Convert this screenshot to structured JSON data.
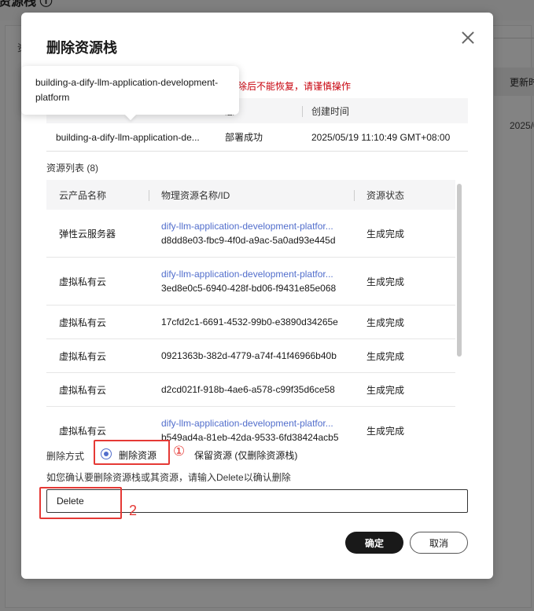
{
  "background": {
    "title": "资源栈 ⓘ",
    "left_text": "资",
    "col_header": "更新时",
    "col_cell": "2025/0"
  },
  "dialog": {
    "title": "删除资源栈",
    "warning": "除后不能恢复，请谨慎操作",
    "tooltip": "building-a-dify-llm-application-development-platform",
    "stack_table": {
      "headers": [
        "",
        "态",
        "创建时间"
      ],
      "row": [
        "building-a-dify-llm-application-de...",
        "部署成功",
        "2025/05/19 11:10:49 GMT+08:00"
      ]
    },
    "resource_label": "资源列表 (8)",
    "resource_table": {
      "headers": [
        "云产品名称",
        "物理资源名称/ID",
        "资源状态"
      ],
      "rows": [
        {
          "product": "弹性云服务器",
          "link": "dify-llm-application-development-platfor...",
          "id": "d8dd8e03-fbc9-4f0d-a9ac-5a0ad93e445d",
          "status": "生成完成"
        },
        {
          "product": "虚拟私有云",
          "link": "dify-llm-application-development-platfor...",
          "id": "3ed8e0c5-6940-428f-bd06-f9431e85e068",
          "status": "生成完成"
        },
        {
          "product": "虚拟私有云",
          "link": "",
          "id": "17cfd2c1-6691-4532-99b0-e3890d34265e",
          "status": "生成完成"
        },
        {
          "product": "虚拟私有云",
          "link": "",
          "id": "0921363b-382d-4779-a74f-41f46966b40b",
          "status": "生成完成"
        },
        {
          "product": "虚拟私有云",
          "link": "",
          "id": "d2cd021f-918b-4ae6-a578-c99f35d6ce58",
          "status": "生成完成"
        },
        {
          "product": "虚拟私有云",
          "link": "dify-llm-application-development-platfor...",
          "id": "b549ad4a-81eb-42da-9533-6fd38424acb5",
          "status": "生成完成"
        }
      ]
    },
    "delete_mode": {
      "label": "删除方式",
      "option_delete": "删除资源",
      "option_keep": "保留资源 (仅删除资源栈)",
      "selected": "删除资源"
    },
    "annotation_1": "1",
    "annotation_2": "2",
    "confirm_hint": "如您确认要删除资源栈或其资源，请输入Delete以确认删除",
    "confirm_input_value": "Delete",
    "ok_label": "确定",
    "cancel_label": "取消"
  },
  "colors": {
    "accent": "#526ecc",
    "warning": "#c7000b",
    "annotation": "#e53935",
    "primary_button": "#191919"
  }
}
